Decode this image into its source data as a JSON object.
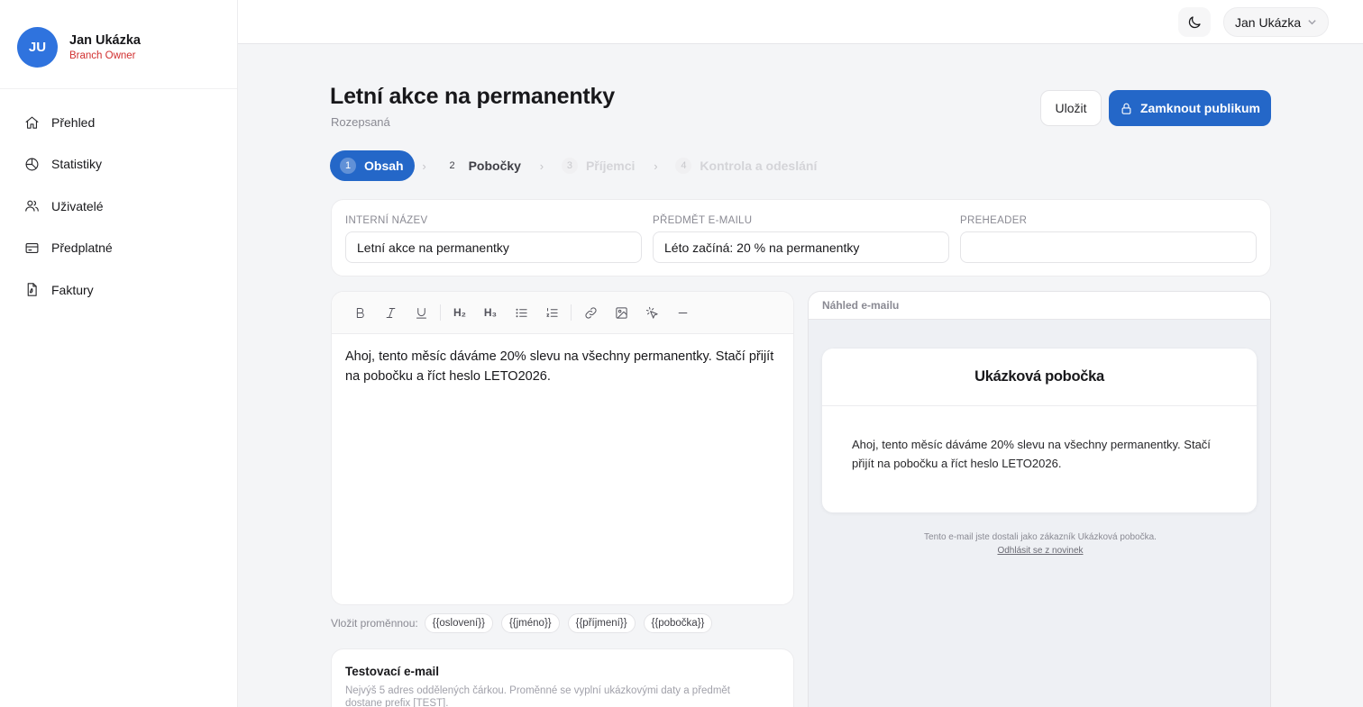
{
  "sidebar": {
    "profile": {
      "initials": "JU",
      "name": "Jan Ukázka",
      "role": "Branch Owner"
    },
    "items": [
      {
        "label": "Přehled",
        "icon": "home-icon"
      },
      {
        "label": "Statistiky",
        "icon": "pie-chart-icon"
      },
      {
        "label": "Uživatelé",
        "icon": "users-icon"
      },
      {
        "label": "Předplatné",
        "icon": "credit-card-icon"
      },
      {
        "label": "Faktury",
        "icon": "file-document-icon"
      }
    ]
  },
  "topbar": {
    "theme_icon": "moon-icon",
    "user_name": "Jan Ukázka"
  },
  "header": {
    "title": "Letní akce na permanentky",
    "status": "Rozepsaná",
    "save_label": "Uložit",
    "lock_label": "Zamknout publikum"
  },
  "steps": [
    {
      "number": "1",
      "label": "Obsah",
      "state": "active"
    },
    {
      "number": "2",
      "label": "Pobočky",
      "state": "normal"
    },
    {
      "number": "3",
      "label": "Příjemci",
      "state": "disabled"
    },
    {
      "number": "4",
      "label": "Kontrola a odeslání",
      "state": "disabled"
    }
  ],
  "fields": {
    "internal_name": {
      "label": "INTERNÍ NÁZEV",
      "value": "Letní akce na permanentky"
    },
    "subject": {
      "label": "PŘEDMĚT E-MAILU",
      "value": "Léto začíná: 20 % na permanentky"
    },
    "preheader": {
      "label": "PREHEADER",
      "value": ""
    }
  },
  "editor": {
    "toolbar": {
      "h2": "H₂",
      "h3": "H₃"
    },
    "content": "Ahoj, tento měsíc dáváme 20% slevu na všechny permanentky. Stačí přijít na pobočku a říct heslo LETO2026."
  },
  "variables": {
    "label": "Vložit proměnnou:",
    "items": [
      "{{oslovení}}",
      "{{jméno}}",
      "{{příjmení}}",
      "{{pobočka}}"
    ]
  },
  "test_email": {
    "title": "Testovací e-mail",
    "description": "Nejvýš 5 adres oddělených čárkou. Proměnné se vyplní ukázkovými daty a předmět dostane prefix [TEST]."
  },
  "preview": {
    "heading": "Náhled e-mailu",
    "branch": "Ukázková pobočka",
    "body": "Ahoj, tento měsíc dáváme 20% slevu na všechny permanentky. Stačí přijít na pobočku a říct heslo LETO2026.",
    "footer": "Tento e-mail jste dostali jako zákazník Ukázková pobočka.",
    "unsubscribe": "Odhlásit se z novinek"
  },
  "colors": {
    "accent": "#2467c8",
    "avatar": "#2f73de",
    "role": "#d12f2f"
  }
}
